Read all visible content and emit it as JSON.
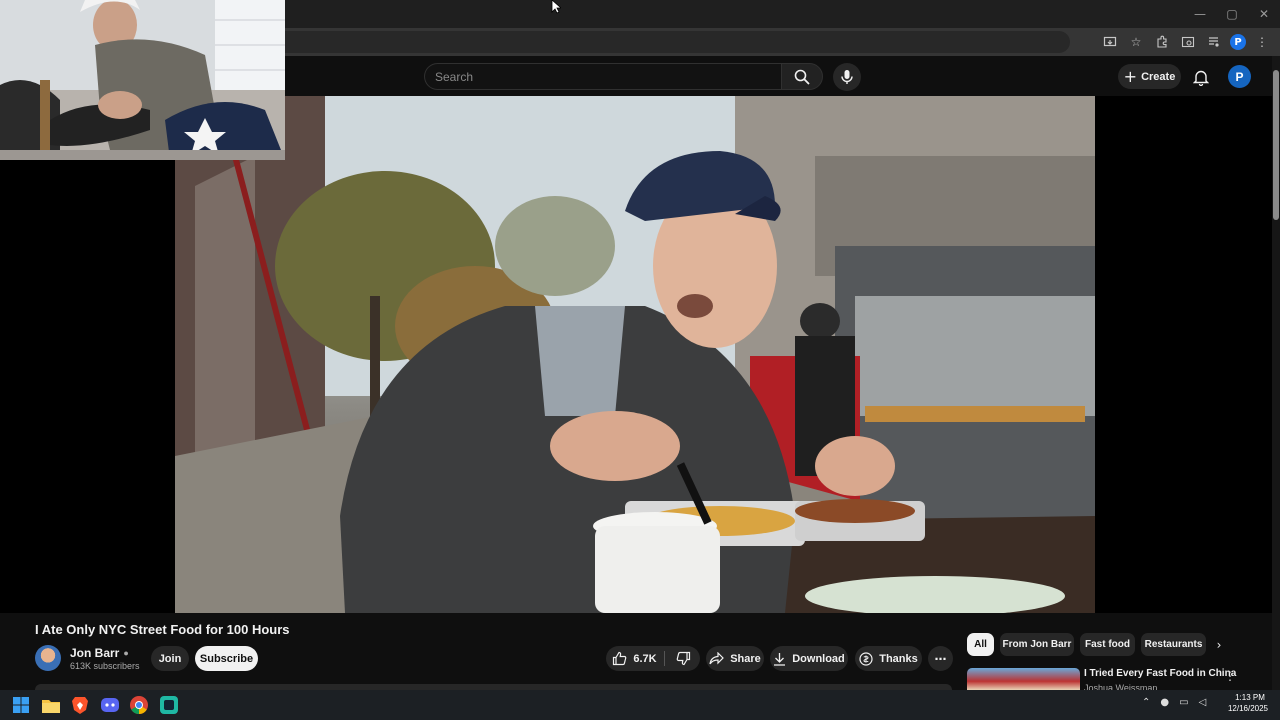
{
  "browser": {
    "window_controls": [
      "—",
      "▢",
      "✕"
    ],
    "toolbar_icons": [
      "install-icon",
      "star-icon",
      "extensions-icon",
      "tab-search-icon",
      "media-icon"
    ],
    "profile_initial": "P"
  },
  "masthead": {
    "search_placeholder": "Search",
    "create_label": "Create",
    "avatar_initial": "P"
  },
  "video": {
    "title": "I Ate Only NYC Street Food for 100 Hours",
    "channel": {
      "name": "Jon Barr",
      "subscribers": "613K subscribers",
      "verified": true
    },
    "join_label": "Join",
    "subscribe_label": "Subscribe",
    "likes": "6.7K",
    "share_label": "Share",
    "download_label": "Download",
    "thanks_label": "Thanks"
  },
  "chips": [
    "All",
    "From Jon Barr",
    "Fast food",
    "Restaurants"
  ],
  "recommended": [
    {
      "title": "I Tried Every Fast Food in China",
      "channel": "Joshua Weissman"
    }
  ],
  "taskbar": {
    "apps": [
      "windows-start-icon",
      "file-explorer-icon",
      "brave-icon",
      "discord-icon",
      "chrome-icon",
      "app-icon"
    ],
    "time": "1:13 PM",
    "date": "12/16/2025"
  },
  "colors": {
    "background": "#0f0f0f",
    "surface": "#272727",
    "accent_blue": "#1565c0",
    "taskbar": "#1c2024"
  }
}
